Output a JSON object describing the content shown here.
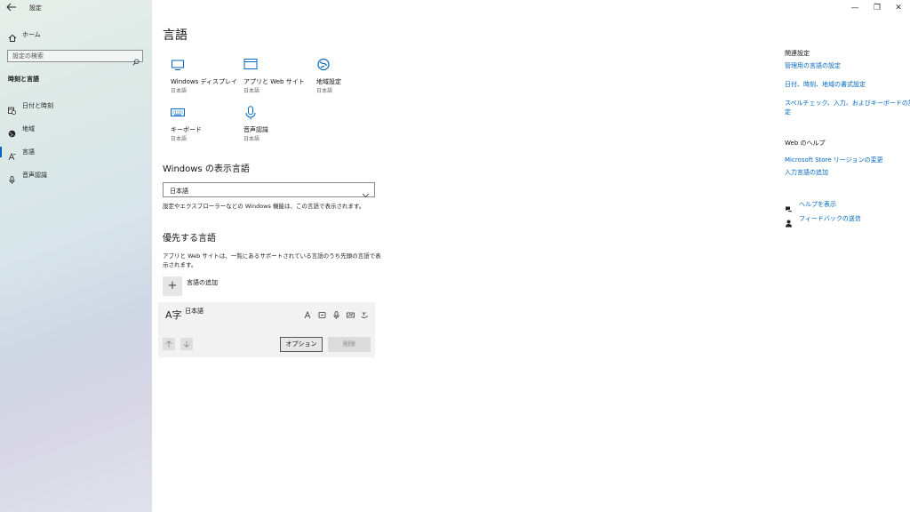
{
  "window": {
    "app_title": "設定",
    "controls": [
      "—",
      "❐",
      "✕"
    ]
  },
  "sidebar": {
    "home": "ホーム",
    "search_placeholder": "設定の検索",
    "section": "時刻と言語",
    "items": [
      {
        "label": "日付と時刻",
        "icon": "calendar-clock-icon"
      },
      {
        "label": "地域",
        "icon": "globe-icon"
      },
      {
        "label": "言語",
        "icon": "language-icon",
        "active": true
      },
      {
        "label": "音声認識",
        "icon": "microphone-icon"
      }
    ]
  },
  "main": {
    "title": "言語",
    "tiles": [
      {
        "label": "Windows ディスプレイ",
        "sub": "日本語",
        "icon": "display-icon"
      },
      {
        "label": "アプリと Web サイト",
        "sub": "日本語",
        "icon": "window-icon"
      },
      {
        "label": "地域設定",
        "sub": "日本語",
        "icon": "globe-icon"
      },
      {
        "label": "キーボード",
        "sub": "日本語",
        "icon": "keyboard-icon"
      },
      {
        "label": "音声認識",
        "sub": "日本語",
        "icon": "microphone-icon"
      }
    ],
    "display_language": {
      "heading": "Windows の表示言語",
      "selected": "日本語",
      "description": "設定やエクスプローラーなどの Windows 機能は、この言語で表示されます。"
    },
    "preferred": {
      "heading": "優先する言語",
      "description_line1": "アプリと Web サイトは、一覧にあるサポートされている言語のうち先頭の言語で表",
      "description_line2": "示されます。",
      "add_label": "言語の追加",
      "language_name": "日本語",
      "language_glyph": "A字",
      "options_button": "オプション",
      "remove_button": "削除"
    }
  },
  "related": {
    "heading": "関連設定",
    "links": [
      "管理用の言語の設定",
      "日付、時刻、地域の書式設定",
      "スペルチェック、入力、およびキーボードの設",
      "定"
    ],
    "web_help_heading": "Web のヘルプ",
    "web_links": [
      "Microsoft Store リージョンの変更",
      "入力言語の追加"
    ],
    "help": "ヘルプを表示",
    "feedback": "フィードバックの送信"
  }
}
